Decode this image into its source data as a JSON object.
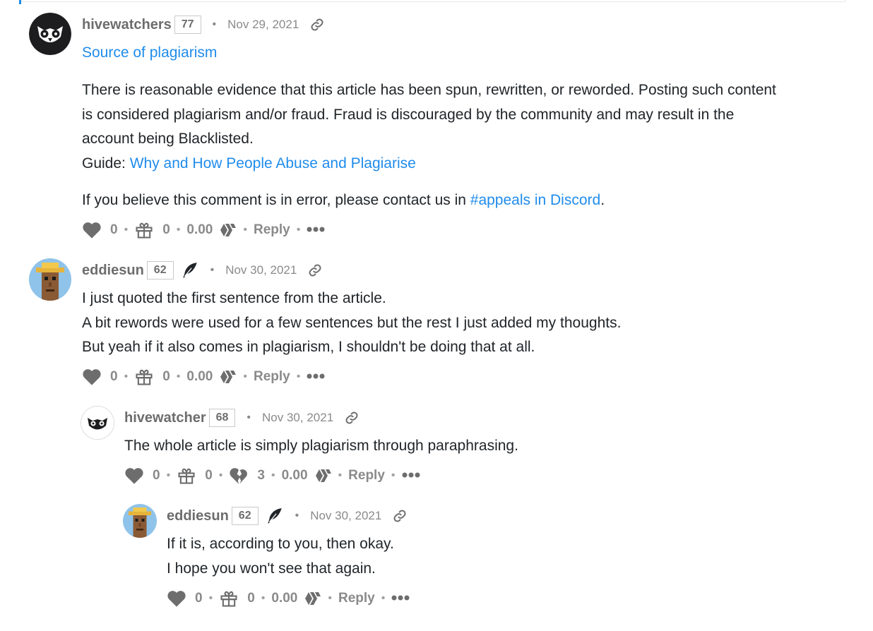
{
  "comments": [
    {
      "author": "hivewatchers",
      "rep": "77",
      "date": "Nov 29, 2021",
      "title_link": "Source of plagiarism",
      "body": {
        "p1": [
          "There is reasonable evidence that this article has been spun, rewritten, or reworded. Posting such content",
          "is considered plagiarism and/or fraud. Fraud is discouraged by the community and may result in the",
          "account being Blacklisted."
        ],
        "guide_label": "Guide: ",
        "guide_link": "Why and How People Abuse and Plagiarise",
        "appeal_prefix": "If you believe this comment is in error, please contact us in ",
        "appeal_link": "#appeals in Discord",
        "appeal_suffix": "."
      },
      "actions": {
        "votes": "0",
        "tips": "0",
        "payout": "0.00",
        "reply": "Reply"
      }
    },
    {
      "author": "eddiesun",
      "rep": "62",
      "date": "Nov 30, 2021",
      "lines": [
        "I just quoted the first sentence from the article.",
        "A bit rewords were used for a few sentences but the rest I just added my thoughts.",
        "But yeah if it also comes in plagiarism, I shouldn't be doing that at all."
      ],
      "actions": {
        "votes": "0",
        "tips": "0",
        "payout": "0.00",
        "reply": "Reply"
      }
    },
    {
      "author": "hivewatcher",
      "rep": "68",
      "date": "Nov 30, 2021",
      "lines": [
        "The whole article is simply plagiarism through paraphrasing."
      ],
      "actions": {
        "votes": "0",
        "tips": "0",
        "downvotes": "3",
        "payout": "0.00",
        "reply": "Reply"
      }
    },
    {
      "author": "eddiesun",
      "rep": "62",
      "date": "Nov 30, 2021",
      "lines": [
        "If it is, according to you, then okay.",
        "I hope you won't see that again."
      ],
      "actions": {
        "votes": "0",
        "tips": "0",
        "payout": "0.00",
        "reply": "Reply"
      }
    }
  ],
  "icons": {
    "upvote": "heart-icon",
    "tip": "gift-icon",
    "downvote": "broken-heart-icon",
    "currency": "hive-icon",
    "more": "more-dots-icon",
    "permalink": "link-icon",
    "verified": "feather-icon"
  },
  "colors": {
    "link": "#1f8ceb",
    "muted": "#8a8a8a",
    "text": "#212529",
    "icon": "#6d6d6d"
  }
}
